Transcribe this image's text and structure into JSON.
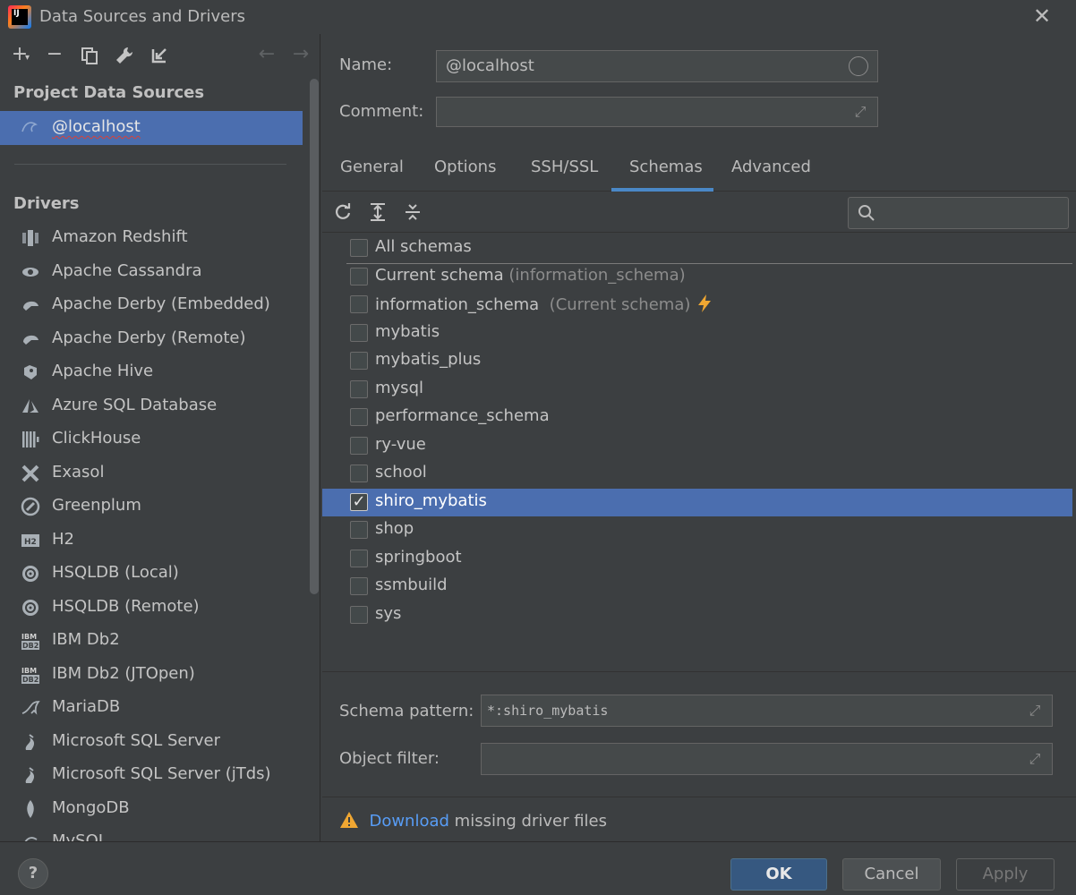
{
  "window": {
    "title": "Data Sources and Drivers",
    "logo_text": "IJ"
  },
  "left": {
    "toolbar": {
      "add_icon": "plus-icon",
      "remove_icon": "minus-icon",
      "duplicate_icon": "copy-icon",
      "driver_icon": "wrench-icon",
      "import_icon": "import-icon",
      "back_icon": "arrow-left-icon",
      "forward_icon": "arrow-right-icon"
    },
    "project_sources_header": "Project Data Sources",
    "sources": [
      {
        "label": "@localhost",
        "selected": true
      }
    ],
    "drivers_header": "Drivers",
    "drivers": [
      {
        "label": "Amazon Redshift",
        "icon": "redshift-icon"
      },
      {
        "label": "Apache Cassandra",
        "icon": "cassandra-icon"
      },
      {
        "label": "Apache Derby (Embedded)",
        "icon": "derby-icon"
      },
      {
        "label": "Apache Derby (Remote)",
        "icon": "derby-icon"
      },
      {
        "label": "Apache Hive",
        "icon": "hive-icon"
      },
      {
        "label": "Azure SQL Database",
        "icon": "azure-icon"
      },
      {
        "label": "ClickHouse",
        "icon": "clickhouse-icon"
      },
      {
        "label": "Exasol",
        "icon": "exasol-icon"
      },
      {
        "label": "Greenplum",
        "icon": "greenplum-icon"
      },
      {
        "label": "H2",
        "icon": "h2-icon"
      },
      {
        "label": "HSQLDB (Local)",
        "icon": "hsqldb-icon"
      },
      {
        "label": "HSQLDB (Remote)",
        "icon": "hsqldb-icon"
      },
      {
        "label": "IBM Db2",
        "icon": "db2-icon"
      },
      {
        "label": "IBM Db2 (JTOpen)",
        "icon": "db2-icon"
      },
      {
        "label": "MariaDB",
        "icon": "mariadb-icon"
      },
      {
        "label": "Microsoft SQL Server",
        "icon": "sqlserver-icon"
      },
      {
        "label": "Microsoft SQL Server (jTds)",
        "icon": "sqlserver-icon"
      },
      {
        "label": "MongoDB",
        "icon": "mongodb-icon"
      },
      {
        "label": "MySQL",
        "icon": "mysql-icon"
      }
    ]
  },
  "right": {
    "name_label": "Name:",
    "name_value": "@localhost",
    "comment_label": "Comment:",
    "comment_value": "",
    "tabs": [
      "General",
      "Options",
      "SSH/SSL",
      "Schemas",
      "Advanced"
    ],
    "active_tab": "Schemas",
    "schema_toolbar": {
      "refresh_icon": "refresh-icon",
      "expand_icon": "expand-all-icon",
      "collapse_icon": "collapse-all-icon",
      "search_placeholder": ""
    },
    "all_schemas": {
      "label": "All schemas",
      "checked": false
    },
    "current_schema": {
      "label": "Current schema",
      "hint": "(information_schema)",
      "checked": false
    },
    "schemas": [
      {
        "label": "information_schema",
        "hint": "(Current schema)",
        "checked": false,
        "current": true
      },
      {
        "label": "mybatis",
        "checked": false
      },
      {
        "label": "mybatis_plus",
        "checked": false
      },
      {
        "label": "mysql",
        "checked": false
      },
      {
        "label": "performance_schema",
        "checked": false
      },
      {
        "label": "ry-vue",
        "checked": false
      },
      {
        "label": "school",
        "checked": false
      },
      {
        "label": "shiro_mybatis",
        "checked": true,
        "selected": true
      },
      {
        "label": "shop",
        "checked": false
      },
      {
        "label": "springboot",
        "checked": false
      },
      {
        "label": "ssmbuild",
        "checked": false
      },
      {
        "label": "sys",
        "checked": false
      }
    ],
    "schema_pattern_label": "Schema pattern:",
    "schema_pattern_value": "*:shiro_mybatis",
    "object_filter_label": "Object filter:",
    "object_filter_value": "",
    "warning": {
      "link": "Download",
      "text": "missing driver files"
    }
  },
  "footer": {
    "help": "?",
    "ok": "OK",
    "cancel": "Cancel",
    "apply": "Apply"
  },
  "colors": {
    "accent": "#4b6eaf",
    "background": "#3c3f41",
    "link": "#589df6",
    "warning": "#f0a732"
  }
}
